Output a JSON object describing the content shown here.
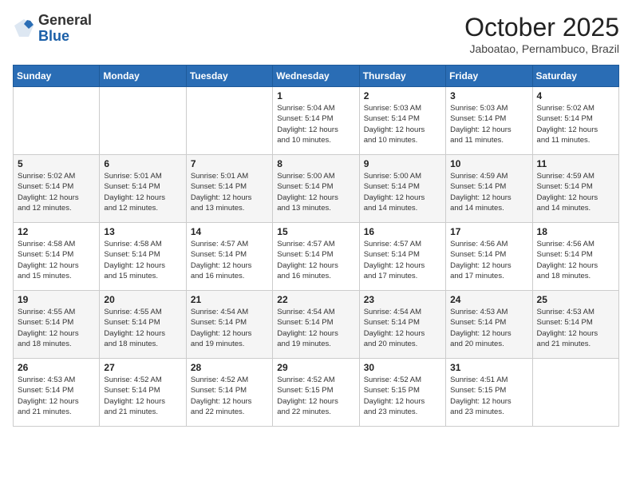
{
  "header": {
    "logo_general": "General",
    "logo_blue": "Blue",
    "month_title": "October 2025",
    "location": "Jaboatao, Pernambuco, Brazil"
  },
  "days_of_week": [
    "Sunday",
    "Monday",
    "Tuesday",
    "Wednesday",
    "Thursday",
    "Friday",
    "Saturday"
  ],
  "weeks": [
    [
      {
        "day": "",
        "info": ""
      },
      {
        "day": "",
        "info": ""
      },
      {
        "day": "",
        "info": ""
      },
      {
        "day": "1",
        "info": "Sunrise: 5:04 AM\nSunset: 5:14 PM\nDaylight: 12 hours\nand 10 minutes."
      },
      {
        "day": "2",
        "info": "Sunrise: 5:03 AM\nSunset: 5:14 PM\nDaylight: 12 hours\nand 10 minutes."
      },
      {
        "day": "3",
        "info": "Sunrise: 5:03 AM\nSunset: 5:14 PM\nDaylight: 12 hours\nand 11 minutes."
      },
      {
        "day": "4",
        "info": "Sunrise: 5:02 AM\nSunset: 5:14 PM\nDaylight: 12 hours\nand 11 minutes."
      }
    ],
    [
      {
        "day": "5",
        "info": "Sunrise: 5:02 AM\nSunset: 5:14 PM\nDaylight: 12 hours\nand 12 minutes."
      },
      {
        "day": "6",
        "info": "Sunrise: 5:01 AM\nSunset: 5:14 PM\nDaylight: 12 hours\nand 12 minutes."
      },
      {
        "day": "7",
        "info": "Sunrise: 5:01 AM\nSunset: 5:14 PM\nDaylight: 12 hours\nand 13 minutes."
      },
      {
        "day": "8",
        "info": "Sunrise: 5:00 AM\nSunset: 5:14 PM\nDaylight: 12 hours\nand 13 minutes."
      },
      {
        "day": "9",
        "info": "Sunrise: 5:00 AM\nSunset: 5:14 PM\nDaylight: 12 hours\nand 14 minutes."
      },
      {
        "day": "10",
        "info": "Sunrise: 4:59 AM\nSunset: 5:14 PM\nDaylight: 12 hours\nand 14 minutes."
      },
      {
        "day": "11",
        "info": "Sunrise: 4:59 AM\nSunset: 5:14 PM\nDaylight: 12 hours\nand 14 minutes."
      }
    ],
    [
      {
        "day": "12",
        "info": "Sunrise: 4:58 AM\nSunset: 5:14 PM\nDaylight: 12 hours\nand 15 minutes."
      },
      {
        "day": "13",
        "info": "Sunrise: 4:58 AM\nSunset: 5:14 PM\nDaylight: 12 hours\nand 15 minutes."
      },
      {
        "day": "14",
        "info": "Sunrise: 4:57 AM\nSunset: 5:14 PM\nDaylight: 12 hours\nand 16 minutes."
      },
      {
        "day": "15",
        "info": "Sunrise: 4:57 AM\nSunset: 5:14 PM\nDaylight: 12 hours\nand 16 minutes."
      },
      {
        "day": "16",
        "info": "Sunrise: 4:57 AM\nSunset: 5:14 PM\nDaylight: 12 hours\nand 17 minutes."
      },
      {
        "day": "17",
        "info": "Sunrise: 4:56 AM\nSunset: 5:14 PM\nDaylight: 12 hours\nand 17 minutes."
      },
      {
        "day": "18",
        "info": "Sunrise: 4:56 AM\nSunset: 5:14 PM\nDaylight: 12 hours\nand 18 minutes."
      }
    ],
    [
      {
        "day": "19",
        "info": "Sunrise: 4:55 AM\nSunset: 5:14 PM\nDaylight: 12 hours\nand 18 minutes."
      },
      {
        "day": "20",
        "info": "Sunrise: 4:55 AM\nSunset: 5:14 PM\nDaylight: 12 hours\nand 18 minutes."
      },
      {
        "day": "21",
        "info": "Sunrise: 4:54 AM\nSunset: 5:14 PM\nDaylight: 12 hours\nand 19 minutes."
      },
      {
        "day": "22",
        "info": "Sunrise: 4:54 AM\nSunset: 5:14 PM\nDaylight: 12 hours\nand 19 minutes."
      },
      {
        "day": "23",
        "info": "Sunrise: 4:54 AM\nSunset: 5:14 PM\nDaylight: 12 hours\nand 20 minutes."
      },
      {
        "day": "24",
        "info": "Sunrise: 4:53 AM\nSunset: 5:14 PM\nDaylight: 12 hours\nand 20 minutes."
      },
      {
        "day": "25",
        "info": "Sunrise: 4:53 AM\nSunset: 5:14 PM\nDaylight: 12 hours\nand 21 minutes."
      }
    ],
    [
      {
        "day": "26",
        "info": "Sunrise: 4:53 AM\nSunset: 5:14 PM\nDaylight: 12 hours\nand 21 minutes."
      },
      {
        "day": "27",
        "info": "Sunrise: 4:52 AM\nSunset: 5:14 PM\nDaylight: 12 hours\nand 21 minutes."
      },
      {
        "day": "28",
        "info": "Sunrise: 4:52 AM\nSunset: 5:14 PM\nDaylight: 12 hours\nand 22 minutes."
      },
      {
        "day": "29",
        "info": "Sunrise: 4:52 AM\nSunset: 5:15 PM\nDaylight: 12 hours\nand 22 minutes."
      },
      {
        "day": "30",
        "info": "Sunrise: 4:52 AM\nSunset: 5:15 PM\nDaylight: 12 hours\nand 23 minutes."
      },
      {
        "day": "31",
        "info": "Sunrise: 4:51 AM\nSunset: 5:15 PM\nDaylight: 12 hours\nand 23 minutes."
      },
      {
        "day": "",
        "info": ""
      }
    ]
  ]
}
